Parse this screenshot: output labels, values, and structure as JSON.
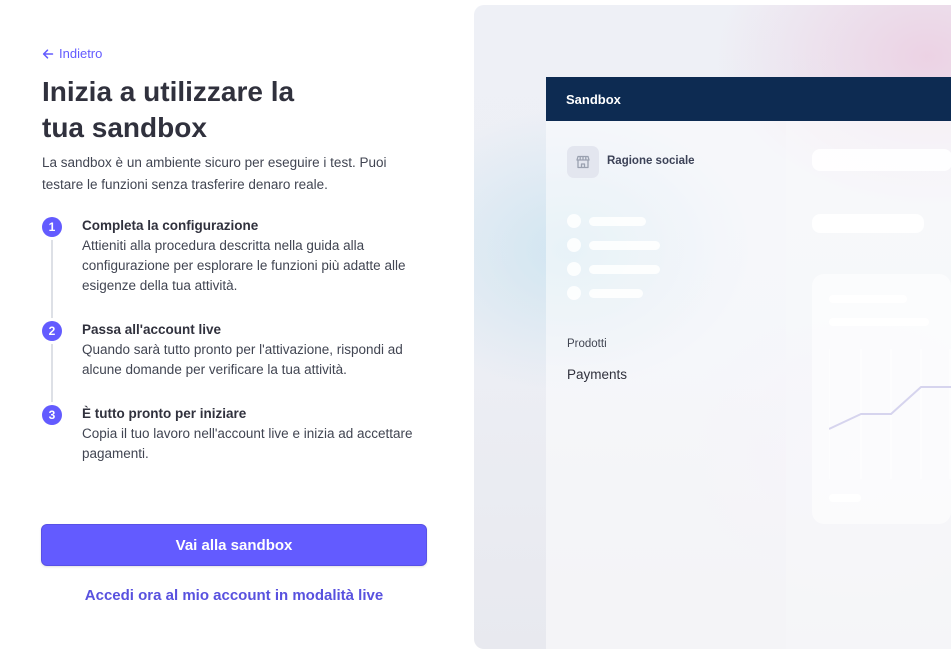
{
  "back": {
    "label": "Indietro"
  },
  "title": "Inizia a utilizzare la tua sandbox",
  "subtitle": "La sandbox è un ambiente sicuro per eseguire i test. Puoi testare le funzioni senza trasferire denaro reale.",
  "steps": [
    {
      "number": "1",
      "title": "Completa la configurazione",
      "description": "Attieniti alla procedura descritta nella guida alla configurazione per esplorare le funzioni più adatte alle esigenze della tua attività."
    },
    {
      "number": "2",
      "title": "Passa all'account live",
      "description": "Quando sarà tutto pronto per l'attivazione, rispondi ad alcune domande per verificare la tua attività."
    },
    {
      "number": "3",
      "title": "È tutto pronto per iniziare",
      "description": "Copia il tuo lavoro nell'account live e inizia ad accettare pagamenti."
    }
  ],
  "primary_button": {
    "label": "Vai alla sandbox"
  },
  "secondary_link": {
    "label": "Accedi ora al mio account in modalità live"
  },
  "preview": {
    "header": "Sandbox",
    "business_name": "Ragione sociale",
    "section_label": "Prodotti",
    "nav_item": "Payments"
  },
  "colors": {
    "accent": "#635bff",
    "link": "#5851df",
    "preview_header_bg": "#0d2b52",
    "text_primary": "#30313d"
  },
  "icons": {
    "back": "arrow-left-icon",
    "business": "storefront-icon"
  }
}
